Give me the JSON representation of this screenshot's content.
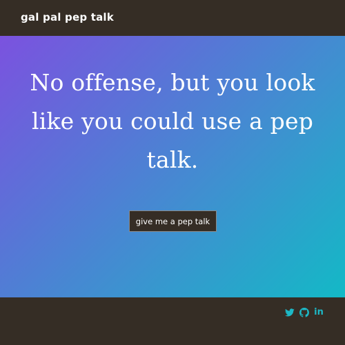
{
  "header": {
    "brand": "gal pal pep talk"
  },
  "hero": {
    "headline_lines": [
      "No offense, but you look",
      "like you could use a pep",
      "talk."
    ],
    "cta_label": "give me a pep talk"
  },
  "footer": {
    "social": [
      {
        "name": "twitter-icon",
        "glyph": ""
      },
      {
        "name": "github-icon",
        "glyph": ""
      },
      {
        "name": "linkedin-icon",
        "glyph": "in"
      }
    ]
  },
  "colors": {
    "dark_bg": "#352d25",
    "gradient_start": "#7b52df",
    "gradient_end": "#13b9c6",
    "icon_accent": "#1db8c6",
    "text_light": "#ffffff"
  }
}
